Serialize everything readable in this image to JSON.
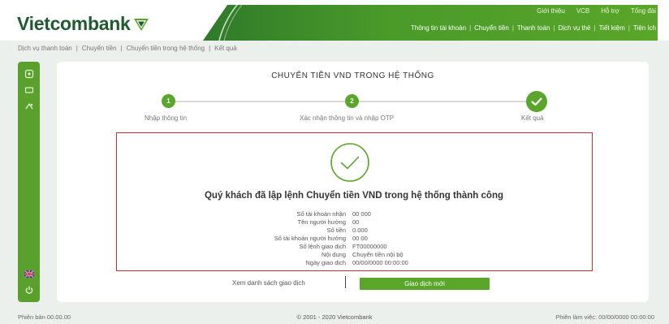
{
  "brand": {
    "name": "Vietcombank",
    "primary_green": "#5aa62a",
    "dark_green": "#1f5b2e",
    "alert_red": "#d42a2a"
  },
  "header": {
    "top_links": [
      "Giới thiệu",
      "VCB",
      "Hỗ trợ",
      "Tổng đài"
    ],
    "nav": [
      "Thông tin tài khoản",
      "Chuyển tiền",
      "Thanh toán",
      "Dịch vụ thẻ",
      "Tiết kiệm",
      "Tiện ích"
    ]
  },
  "breadcrumb": [
    "Dịch vụ thanh toán",
    "|",
    "Chuyển tiền",
    "|",
    "Chuyển tiền trong hệ thống",
    "|",
    "Kết quả"
  ],
  "sidebar": {
    "icons": [
      "home-icon",
      "message-icon",
      "settings-icon",
      "flag-icon",
      "power-icon"
    ]
  },
  "page": {
    "title": "CHUYỂN TIỀN VND TRONG HỆ THỐNG"
  },
  "steps": [
    {
      "number": "1",
      "label": "Nhập thông tin"
    },
    {
      "number": "2",
      "label": "Xác nhận thông tin và nhập OTP"
    },
    {
      "number": "",
      "label": "Kết quả"
    }
  ],
  "result": {
    "success_title": "Quý khách đã lập lệnh Chuyển tiền VND trong hệ thống thành công",
    "details": [
      {
        "label": "Số tài khoản nhận",
        "value": "00          000"
      },
      {
        "label": "Tên người hưởng",
        "value": "              00"
      },
      {
        "label": "Số tiền",
        "value": "          0.000"
      },
      {
        "label": "Số tài khoản người hưởng",
        "value": "00        00"
      },
      {
        "label": "Số lệnh giao dịch",
        "value": "FT00000000"
      },
      {
        "label": "Nội dung",
        "value": "Chuyển tiền nội bộ"
      },
      {
        "label": "Ngày giao dịch",
        "value": "00/00/0000 00:00:00"
      }
    ]
  },
  "actions": {
    "view_history": "Xem danh sách giao dịch",
    "new_transaction": "Giao dịch mới"
  },
  "footer": {
    "left": "Phiên bản 00.00.00",
    "center": "© 2001 - 2020 Vietcombank",
    "right": "Phiên làm việc: 00/00/0000 00:00:00"
  }
}
